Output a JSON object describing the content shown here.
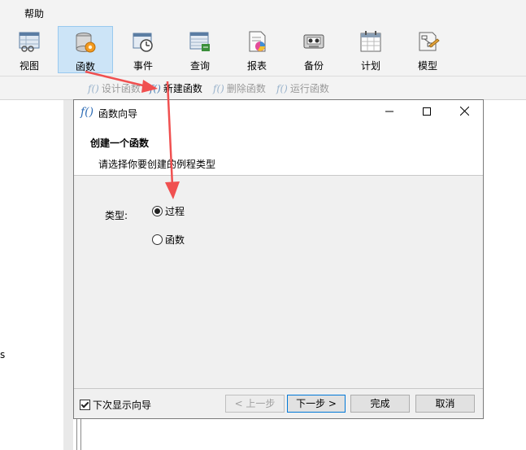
{
  "menubar": {
    "help": "帮助"
  },
  "toolbar": {
    "items": [
      {
        "label": "视图",
        "icon": "view-icon"
      },
      {
        "label": "函数",
        "icon": "function-icon",
        "selected": true
      },
      {
        "label": "事件",
        "icon": "event-icon"
      },
      {
        "label": "查询",
        "icon": "query-icon"
      },
      {
        "label": "报表",
        "icon": "report-icon"
      },
      {
        "label": "备份",
        "icon": "backup-icon"
      },
      {
        "label": "计划",
        "icon": "schedule-icon"
      },
      {
        "label": "模型",
        "icon": "model-icon"
      }
    ]
  },
  "subtoolbar": {
    "design": "设计函数",
    "new": "新建函数",
    "delete": "删除函数",
    "run": "运行函数"
  },
  "left_panel": {
    "text": "s"
  },
  "dialog": {
    "title": "函数向导",
    "header_title": "创建一个函数",
    "header_subtitle": "请选择你要创建的例程类型",
    "type_label": "类型:",
    "options": [
      {
        "label": "过程",
        "checked": true
      },
      {
        "label": "函数",
        "checked": false
      }
    ],
    "show_next_time": "下次显示向导",
    "show_next_time_checked": true,
    "buttons": {
      "prev": "< 上一步",
      "next": "下一步 >",
      "finish": "完成",
      "cancel": "取消"
    }
  },
  "colors": {
    "accent": "#0078d7",
    "selected_bg": "#cce4f7",
    "annotation_arrow": "#f05050"
  }
}
